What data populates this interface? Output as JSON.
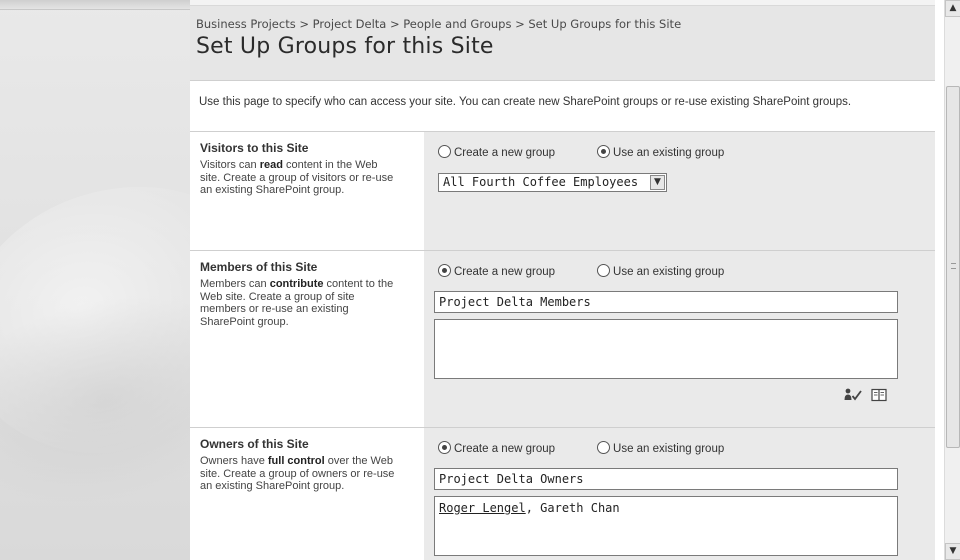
{
  "breadcrumb": "Business Projects > Project Delta > People and Groups > Set Up Groups for this Site",
  "page_title": "Set Up Groups for this Site",
  "intro": "Use this page to specify who can access your site. You can create new SharePoint groups or re-use existing SharePoint groups.",
  "options": {
    "create_label": "Create a new group",
    "existing_label": "Use an existing group"
  },
  "visitors": {
    "title": "Visitors to this Site",
    "text_before": "Visitors can ",
    "emphasis": "read",
    "text_after": " content in the Web site. Create a group of visitors or re-use an existing SharePoint group.",
    "selected_option": "existing",
    "select_value": "All Fourth Coffee Employees"
  },
  "members": {
    "title": "Members of this Site",
    "text_before": "Members can ",
    "emphasis": "contribute",
    "text_after": " content to the Web site. Create a group of site members or re-use an existing SharePoint group.",
    "selected_option": "create",
    "group_name": "Project Delta Members",
    "people": ""
  },
  "owners": {
    "title": "Owners of this Site",
    "text_before": "Owners have ",
    "emphasis": "full control",
    "text_after": " over the Web site. Create a group of owners or re-use an existing SharePoint group.",
    "selected_option": "create",
    "group_name": "Project Delta Owners",
    "people_1": "Roger Lengel",
    "people_sep": ", ",
    "people_2": "Gareth Chan"
  },
  "icons": {
    "check_names": "check-names-icon",
    "browse": "address-book-icon",
    "scroll_up": "chevron-up-icon",
    "scroll_down": "chevron-down-icon"
  }
}
